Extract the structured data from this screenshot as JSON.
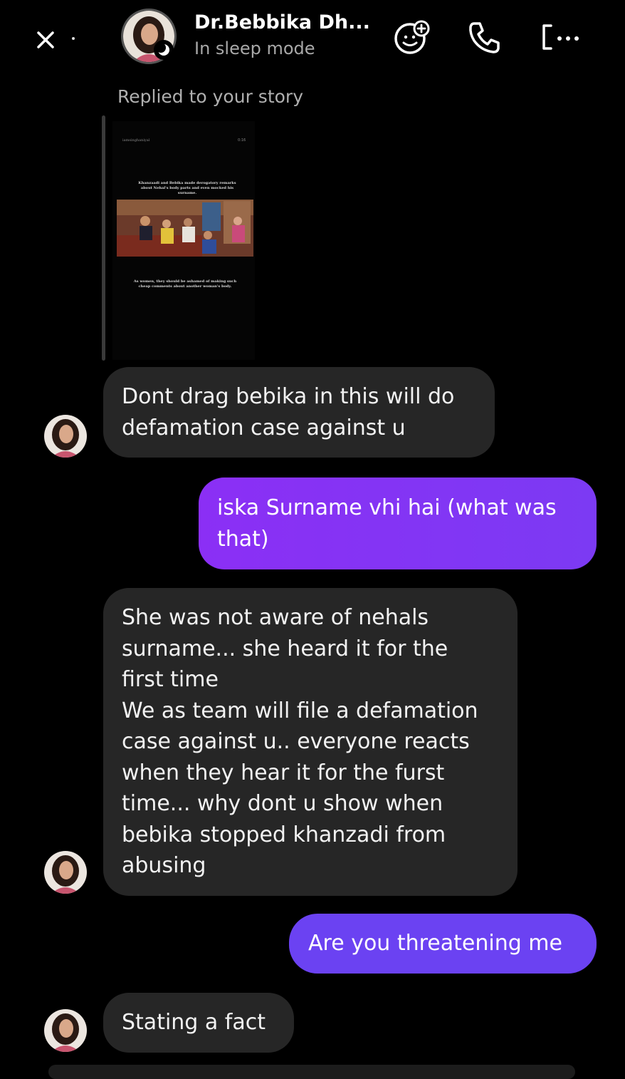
{
  "header": {
    "contact_name": "Dr.Bebbika Dh...",
    "status": "In sleep mode",
    "icons": [
      "close-icon",
      "avatar",
      "moon-icon",
      "sticker-add-icon",
      "phone-icon",
      "video-icon"
    ]
  },
  "story_reply": {
    "label": "Replied to your story",
    "handle": "iamsinghaniyal",
    "time": "0:16",
    "caption_top": "Khanzaadi and Bebika made derogatory remarks about Nehal's body parts and even mocked his surname.",
    "caption_bottom": "As women, they should be ashamed of making such cheap comments about another woman's body."
  },
  "messages": [
    {
      "direction": "incoming",
      "lines": [
        "Dont drag bebika in this will do",
        "defamation case against u"
      ]
    },
    {
      "direction": "outgoing",
      "lines": [
        "iska Surname vhi hai (what was",
        "that)"
      ]
    },
    {
      "direction": "incoming",
      "lines": [
        "She was not aware of nehals",
        "surname... she heard it for the",
        "first time",
        "We as team will file a defamation",
        "case against u.. everyone reacts",
        "when they hear it for the furst",
        "time... why dont u show when",
        "bebika stopped khanzadi from",
        "abusing"
      ]
    },
    {
      "direction": "outgoing",
      "lines": [
        "Are you threatening me"
      ]
    },
    {
      "direction": "incoming",
      "lines": [
        "Stating a fact"
      ]
    }
  ],
  "colors": {
    "background": "#000000",
    "incoming_bubble": "#262626",
    "outgoing_bubble_1": "#8b2ff5",
    "outgoing_bubble_2": "#6b42f2",
    "secondary_text": "#a8a8a8"
  }
}
